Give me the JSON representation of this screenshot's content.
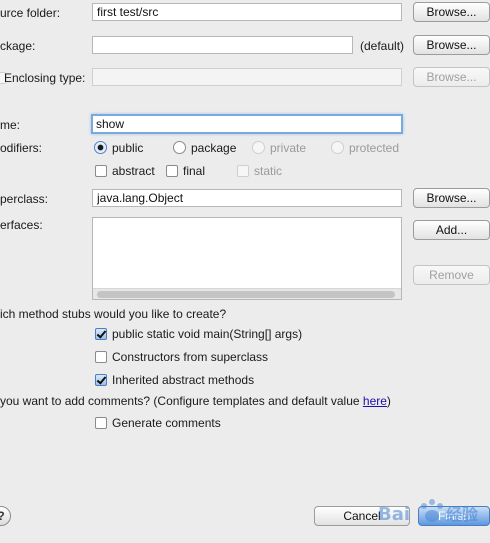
{
  "source_folder": {
    "label": "urce folder:",
    "value": "first test/src",
    "browse": "Browse..."
  },
  "package": {
    "label": "ckage:",
    "value": "",
    "default_hint": "(default)",
    "browse": "Browse..."
  },
  "enclosing": {
    "label": "Enclosing type:",
    "value": "",
    "browse": "Browse..."
  },
  "name": {
    "label": "me:",
    "value": "show"
  },
  "modifiers": {
    "label": "odifiers:",
    "public": "public",
    "package": "package",
    "private": "private",
    "protected": "protected",
    "abstract": "abstract",
    "final": "final",
    "static": "static",
    "selected": "public"
  },
  "superclass": {
    "label": "perclass:",
    "value": "java.lang.Object",
    "browse": "Browse..."
  },
  "interfaces": {
    "label": "erfaces:",
    "add": "Add...",
    "remove": "Remove"
  },
  "stubs": {
    "question": "ich method stubs would you like to create?",
    "main": "public static void main(String[] args)",
    "main_checked": true,
    "constructors": "Constructors from superclass",
    "constructors_checked": false,
    "inherited": "Inherited abstract methods",
    "inherited_checked": true
  },
  "comments": {
    "question": " you want to add comments? (Configure templates and default value ",
    "link": "here",
    "close_paren": ")",
    "generate": "Generate comments",
    "generate_checked": false
  },
  "footer": {
    "help": "?",
    "cancel": "Cancel",
    "finish": "Finish"
  },
  "watermark": "Bai百 经验"
}
